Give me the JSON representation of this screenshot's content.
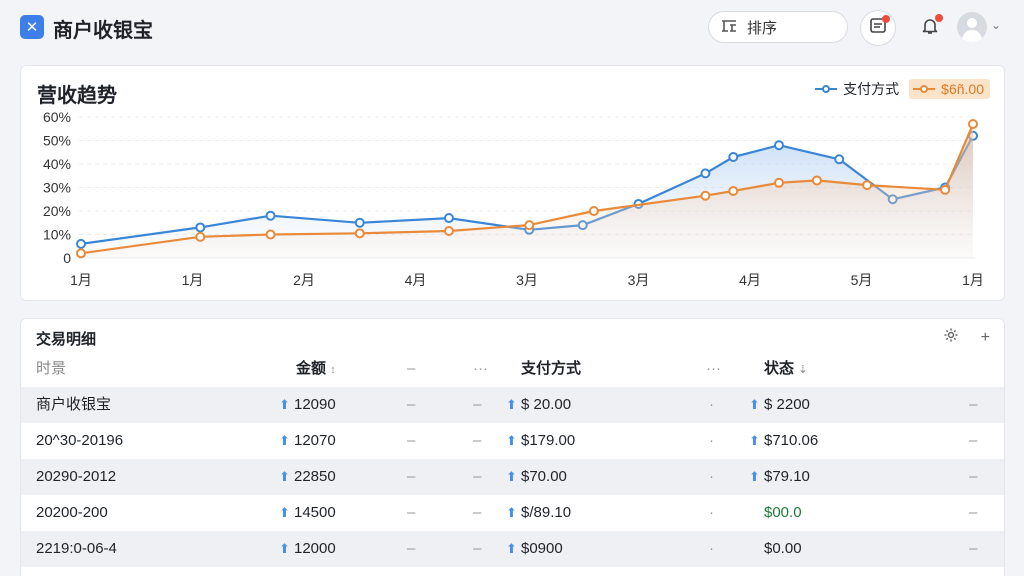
{
  "header": {
    "app_title": "商户收银宝",
    "logo_glyph": "✕",
    "sort_label": "排序",
    "sort_icon": "sort-icon",
    "message_icon": "message-icon",
    "bell_icon": "bell-icon",
    "avatar_icon": "user-avatar-icon"
  },
  "chart": {
    "title": "营收趋势",
    "legend": [
      {
        "name": "支付方式",
        "color": "#3a86d6"
      },
      {
        "name": "$6ñ.00",
        "color": "#e98a3a"
      }
    ]
  },
  "chart_data": {
    "type": "line",
    "title": "营收趋势",
    "xlabel": "",
    "ylabel": "",
    "categories": [
      "1月",
      "1月",
      "2月",
      "4月",
      "3月",
      "3月",
      "4月",
      "5月",
      "1月"
    ],
    "y_ticks": [
      "0",
      "10%",
      "20%",
      "30%",
      "40%",
      "50%",
      "60%"
    ],
    "ylim": [
      0,
      60
    ],
    "grid": true,
    "legend_position": "top-right",
    "series": [
      {
        "name": "支付方式",
        "color": "#3a86d6",
        "x": [
          0,
          1.07,
          1.7,
          2.5,
          3.3,
          4.02,
          4.5,
          5.0,
          5.6,
          5.85,
          6.26,
          6.8,
          7.28,
          7.75,
          8.0
        ],
        "values": [
          6,
          13,
          18,
          15,
          17,
          12,
          14,
          23,
          36,
          43,
          48,
          42,
          25,
          30,
          52
        ]
      },
      {
        "name": "$6ñ.00",
        "color": "#e98a3a",
        "x": [
          0,
          1.07,
          1.7,
          2.5,
          3.3,
          4.02,
          4.6,
          5.6,
          5.85,
          6.26,
          6.6,
          7.05,
          7.75,
          8.0
        ],
        "values": [
          2,
          9,
          10,
          10.5,
          11.5,
          14,
          20,
          26.5,
          28.5,
          32,
          33,
          31,
          29,
          57
        ]
      }
    ]
  },
  "table": {
    "title": "交易明细",
    "tool_icons": [
      "settings-icon",
      "add-icon"
    ],
    "headers": {
      "time": "时景",
      "amount": "金额",
      "amount_sort": "↕",
      "payment": "支付方式",
      "status": "状态",
      "status_sort": "⇣"
    },
    "rows": [
      {
        "time": "商户收银宝",
        "amount": "12090",
        "payment": "$ 20.00",
        "status": "$ 2200",
        "status_arrow": true
      },
      {
        "time": "20^30-20196",
        "amount": "12070",
        "payment": "$179.00",
        "status": "$710.06",
        "status_arrow": true
      },
      {
        "time": "20290-2012",
        "amount": "22850",
        "payment": "$70.00",
        "status": "$79.10",
        "status_arrow": true
      },
      {
        "time": "20200-200",
        "amount": "14500",
        "payment": "$/89.10",
        "status": "$00.0",
        "status_arrow": false
      },
      {
        "time": "2219:0-06-4",
        "amount": "12000",
        "payment": "$0900",
        "status": "$0.00",
        "status_arrow": false
      }
    ]
  }
}
